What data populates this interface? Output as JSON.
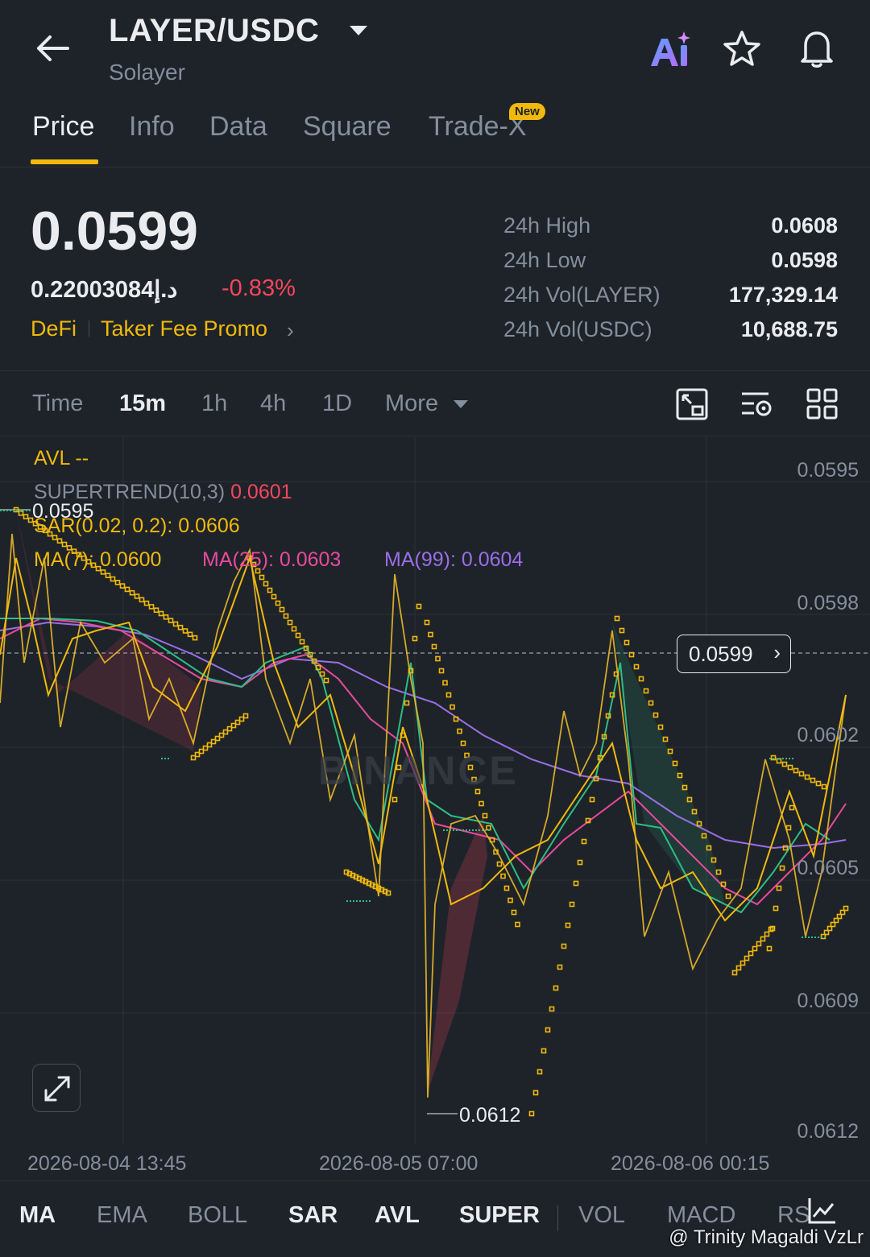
{
  "header": {
    "pair": "LAYER/USDC",
    "name": "Solayer"
  },
  "tabs": [
    "Price",
    "Info",
    "Data",
    "Square",
    "Trade-X"
  ],
  "tab_badge": "New",
  "price": {
    "last": "0.0599",
    "fiat": "0.22003084د.إ",
    "change": "-0.83%",
    "tag": "DeFi",
    "promo": "Taker Fee Promo"
  },
  "stats": [
    {
      "label": "24h High",
      "value": "0.0608"
    },
    {
      "label": "24h Low",
      "value": "0.0598"
    },
    {
      "label": "24h Vol(LAYER)",
      "value": "177,329.14"
    },
    {
      "label": "24h Vol(USDC)",
      "value": "10,688.75"
    }
  ],
  "intervals": [
    "Time",
    "15m",
    "1h",
    "4h",
    "1D",
    "More"
  ],
  "active_interval": "15m",
  "chart": {
    "avl": "AVL --",
    "supertrend_label": "SUPERTREND(10,3)",
    "supertrend_value": "0.0601",
    "sar_label": "SAR(0.02, 0.2): 0.0606",
    "ma7": "MA(7): 0.0600",
    "ma25": "MA(25): 0.0603",
    "ma99": "MA(99): 0.0604",
    "y_ticks": [
      "0.0595",
      "0.0598",
      "0.0602",
      "0.0605",
      "0.0609",
      "0.0612"
    ],
    "x_ticks": [
      "2026-08-04 13:45",
      "2026-08-05 07:00",
      "2026-08-06 00:15"
    ],
    "current_price_tag": "0.0599",
    "high_marker": "0.0595",
    "low_marker": "0.0612",
    "watermark": "BINANCE",
    "colors": {
      "up": "#2ebd85",
      "down": "#f6465d",
      "sar": "#f0b90b",
      "ma7": "#f0b90b",
      "ma25": "#e84a9c",
      "ma99": "#9a6ee8"
    }
  },
  "indicators": [
    "MA",
    "EMA",
    "BOLL",
    "SAR",
    "AVL",
    "SUPER",
    "VOL",
    "MACD",
    "RS"
  ],
  "active_indicators": [
    "MA",
    "SAR",
    "AVL",
    "SUPER"
  ],
  "credit": "@ Trinity Magaldi VzLr",
  "icons": [
    "back-arrow-icon",
    "caret-down-icon",
    "ai-icon",
    "star-icon",
    "bell-icon",
    "fullscreen-icon",
    "indicator-settings-icon",
    "grid-layout-icon",
    "expand-icon",
    "chart-type-icon",
    "binance-logo-icon"
  ]
}
